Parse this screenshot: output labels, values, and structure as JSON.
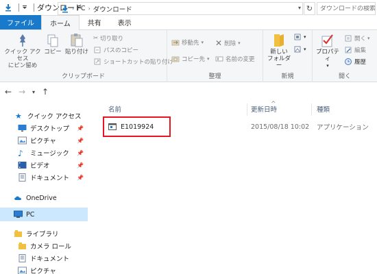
{
  "window": {
    "title": "ダウンロード"
  },
  "ribbon_tabs": [
    "ファイル",
    "ホーム",
    "共有",
    "表示"
  ],
  "ribbon": {
    "clipboard": {
      "label": "クリップボード",
      "pin_quick": "クイック アクセス\nにピン留め",
      "copy": "コピー",
      "paste": "貼り付け",
      "cut": "切り取り",
      "copy_path": "パスのコピー",
      "paste_shortcut": "ショートカットの貼り付け"
    },
    "organize": {
      "label": "整理",
      "move_to": "移動先",
      "copy_to": "コピー先",
      "delete": "削除",
      "rename": "名前の変更"
    },
    "new": {
      "label": "新規",
      "new_folder": "新しい\nフォルダー"
    },
    "open": {
      "label": "開く",
      "properties": "プロパティ",
      "open": "開く",
      "edit": "編集",
      "history": "履歴"
    }
  },
  "address": {
    "crumbs": [
      "PC",
      "ダウンロード"
    ],
    "search_placeholder": "ダウンロードの検索"
  },
  "nav": {
    "quick_access": "クイック アクセス",
    "desktop": "デスクトップ",
    "pictures": "ピクチャ",
    "music": "ミュージック",
    "videos": "ビデオ",
    "documents": "ドキュメント",
    "onedrive": "OneDrive",
    "pc": "PC",
    "libraries": "ライブラリ",
    "camera_roll": "カメラ ロール",
    "lib_documents": "ドキュメント",
    "lib_pictures": "ピクチャ"
  },
  "columns": {
    "name": "名前",
    "modified": "更新日時",
    "type": "種類"
  },
  "files": [
    {
      "name": "E1019924",
      "modified": "2015/08/18 10:02",
      "type": "アプリケーション"
    }
  ],
  "colors": {
    "file_tab": "#1979ca",
    "highlight_border": "#e8141f",
    "selected_nav": "#cce8ff"
  }
}
